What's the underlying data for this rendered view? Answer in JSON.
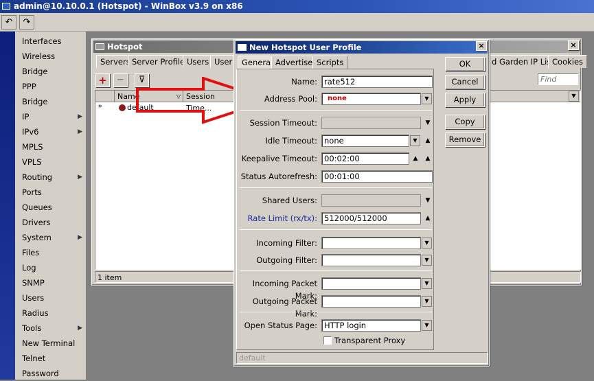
{
  "app": {
    "title": "admin@10.10.0.1 (Hotspot) - WinBox v3.9 on x86"
  },
  "toolbar": {
    "undo_icon": "undo-icon",
    "redo_icon": "redo-icon"
  },
  "menu": {
    "items": [
      {
        "label": "Interfaces",
        "submenu": false
      },
      {
        "label": "Wireless",
        "submenu": false
      },
      {
        "label": "Bridge",
        "submenu": false
      },
      {
        "label": "PPP",
        "submenu": false
      },
      {
        "label": "Bridge",
        "submenu": false
      },
      {
        "label": "IP",
        "submenu": true
      },
      {
        "label": "IPv6",
        "submenu": true
      },
      {
        "label": "MPLS",
        "submenu": false
      },
      {
        "label": "VPLS",
        "submenu": false
      },
      {
        "label": "Routing",
        "submenu": true
      },
      {
        "label": "Ports",
        "submenu": false
      },
      {
        "label": "Queues",
        "submenu": false
      },
      {
        "label": "Drivers",
        "submenu": false
      },
      {
        "label": "System",
        "submenu": true
      },
      {
        "label": "Files",
        "submenu": false
      },
      {
        "label": "Log",
        "submenu": false
      },
      {
        "label": "SNMP",
        "submenu": false
      },
      {
        "label": "Users",
        "submenu": false
      },
      {
        "label": "Radius",
        "submenu": false
      },
      {
        "label": "Tools",
        "submenu": true
      },
      {
        "label": "New Terminal",
        "submenu": false
      },
      {
        "label": "Telnet",
        "submenu": false
      },
      {
        "label": "Password",
        "submenu": false
      }
    ]
  },
  "hotspot": {
    "title": "Hotspot",
    "tabs": [
      "Servers",
      "Server Profiles",
      "Users",
      "User P"
    ],
    "tabs_right": [
      "d Garden IP List",
      "Cookies"
    ],
    "find_placeholder": "Find",
    "columns": [
      "Name",
      "Session Time..."
    ],
    "row": {
      "flag": "*",
      "name": "default"
    },
    "status": "1 item"
  },
  "dialog": {
    "title": "New Hotspot User Profile",
    "tabs": [
      "General",
      "Advertise",
      "Scripts"
    ],
    "fields": {
      "name": {
        "label": "Name:",
        "value": "rate512"
      },
      "address_pool": {
        "label": "Address Pool:",
        "value": "none"
      },
      "session_timeout": {
        "label": "Session Timeout:",
        "value": ""
      },
      "idle_timeout": {
        "label": "Idle Timeout:",
        "value": "none"
      },
      "keepalive_timeout": {
        "label": "Keepalive Timeout:",
        "value": "00:02:00"
      },
      "status_autorefresh": {
        "label": "Status Autorefresh:",
        "value": "00:01:00"
      },
      "shared_users": {
        "label": "Shared Users:",
        "value": ""
      },
      "rate_limit": {
        "label": "Rate Limit (rx/tx):",
        "value": "512000/512000"
      },
      "incoming_filter": {
        "label": "Incoming Filter:",
        "value": ""
      },
      "outgoing_filter": {
        "label": "Outgoing Filter:",
        "value": ""
      },
      "incoming_packet_mark": {
        "label": "Incoming Packet Mark:",
        "value": ""
      },
      "outgoing_packet_mark": {
        "label": "Outgoing Packet Mark:",
        "value": ""
      },
      "open_status_page": {
        "label": "Open Status Page:",
        "value": "HTTP login"
      },
      "transparent_proxy": {
        "label": "Transparent Proxy",
        "checked": false
      }
    },
    "buttons": [
      "OK",
      "Cancel",
      "Apply",
      "Copy",
      "Remove"
    ],
    "status": "default"
  },
  "colors": {
    "title_bar": "#1a3a8a",
    "window_bg": "#d4d0c8",
    "arrow_red": "#e01010",
    "link_label": "#1a2ba0",
    "none_value": "#c00000"
  }
}
